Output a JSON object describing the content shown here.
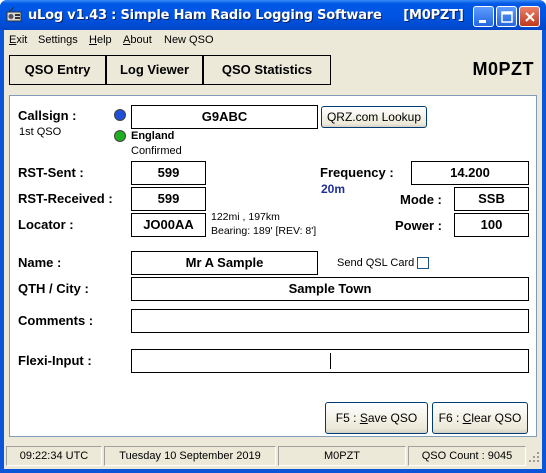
{
  "window": {
    "title": "uLog v1.43 : Simple Ham Radio Logging Software     [M0PZT]",
    "app_icon": "radio-icon"
  },
  "menu": [
    "Exit",
    "Settings",
    "Help",
    "About",
    "New QSO"
  ],
  "menu_underline": [
    "E",
    "S",
    "H",
    "A",
    ""
  ],
  "tabs": [
    "QSO Entry",
    "Log Viewer",
    "QSO Statistics"
  ],
  "operator_callsign": "M0PZT",
  "form": {
    "callsign_label": "Callsign :",
    "qso_number": "1st QSO",
    "callsign_value": "G9ABC",
    "qrz_button": "QRZ.com Lookup",
    "country": "England",
    "confirmed": "Confirmed",
    "rst_sent_label": "RST-Sent :",
    "rst_sent_value": "599",
    "rst_received_label": "RST-Received :",
    "rst_received_value": "599",
    "locator_label": "Locator :",
    "locator_value": "JO00AA",
    "distance": "122mi , 197km",
    "bearing": "Bearing: 189' [REV: 8']",
    "frequency_label": "Frequency :",
    "frequency_value": "14.200",
    "band": "20m",
    "mode_label": "Mode :",
    "mode_value": "SSB",
    "power_label": "Power :",
    "power_value": "100",
    "name_label": "Name :",
    "name_value": "Mr A Sample",
    "send_qsl_label": "Send QSL Card",
    "send_qsl_checked": false,
    "qth_label": "QTH / City :",
    "qth_value": "Sample Town",
    "comments_label": "Comments :",
    "comments_value": "",
    "flexi_label": "Flexi-Input :",
    "flexi_value": "",
    "save_button": "F5 : Save QSO",
    "clear_button": "F6 : Clear QSO"
  },
  "status": {
    "time": "09:22:34  UTC",
    "date": "Tuesday 10 September 2019",
    "callsign": "M0PZT",
    "qso_count": "QSO Count : 9045"
  },
  "colors": {
    "titlebar": "#0054e3",
    "band": "#1f2f9a",
    "lookup_dot": "#1f4fd8",
    "confirmed_dot": "#1fae1f"
  }
}
